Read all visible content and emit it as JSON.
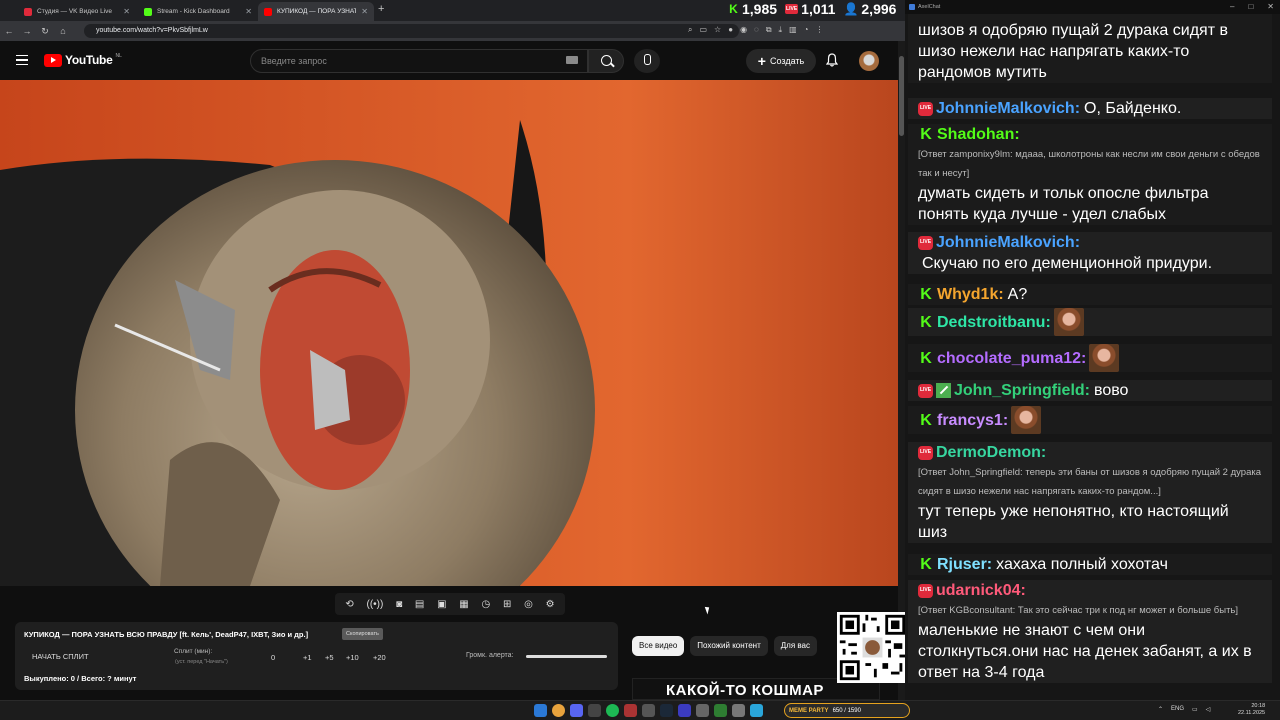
{
  "browser": {
    "tabs": [
      {
        "title": "Студия — VK Видео Live",
        "color": "#e02a3b"
      },
      {
        "title": "Stream - Kick Dashboard",
        "color": "#53fc18"
      },
      {
        "title": "КУПИКОД — ПОРА УЗНАТ",
        "color": "#ff0000"
      }
    ],
    "url": "youtube.com/watch?v=PkvSbfjlmLw"
  },
  "stream_stats": {
    "kick_viewers": "1,985",
    "vk_viewers": "1,011",
    "total_viewers": "2,996"
  },
  "youtube": {
    "logo_text": "YouTube",
    "logo_country": "NL",
    "search_placeholder": "Введите запрос",
    "create_label": "Создать"
  },
  "player_overlay": {
    "split_title": "КУПИКОД — ПОРА УЗНАТЬ ВСЮ ПРАВДУ [ft. Кель', DeadP47, IXBT, Зио и др.]",
    "split_tag": "Скопировать",
    "start_split": "НАЧАТЬ СПЛИТ",
    "split_label": "Сплит (мин):",
    "split_hint": "(уст. перед \"Начать\")",
    "split_value": "0",
    "steps": [
      "+1",
      "+5",
      "+10",
      "+20"
    ],
    "alert_label": "Громк. алерта:",
    "alert_level": 1.0,
    "bought": "Выкуплено: 0 / Всего: ? минут"
  },
  "chips": [
    "Все видео",
    "Похожий контент",
    "Для вас"
  ],
  "thumbnail_text": "КАКОЙ-ТО КОШМАР",
  "chat": {
    "window_title": "AxelChat",
    "messages": [
      {
        "platform": "",
        "nick": "",
        "nick_color": "#ffffff",
        "reply": "",
        "text": "шизов я одобряю   пущай 2 дурака сидят в шизо нежели нас напрягать каких-то рандомов мутить",
        "emote": false
      },
      {
        "platform": "vk",
        "nick": "JohnnieMalkovich:",
        "nick_color": "#4aa3ff",
        "reply": "",
        "text": "О, Байденко.",
        "emote": false
      },
      {
        "platform": "kick",
        "nick": "Shadohan:",
        "nick_color": "#53fc18",
        "reply": "[Ответ zamponixy9lm: мдааа, школотроны как несли им свои деньги с обедов так и несут]",
        "text": "думать сидеть и тольк опосле фильтра понять куда лучше - удел слабых",
        "emote": false
      },
      {
        "platform": "vk",
        "nick": "JohnnieMalkovich:",
        "nick_color": "#4aa3ff",
        "reply": "",
        "text": "Скучаю по его деменционной придури.",
        "emote": false
      },
      {
        "platform": "kick",
        "nick": "Whyd1k:",
        "nick_color": "#f4a52e",
        "reply": "",
        "text": "А?",
        "emote": false
      },
      {
        "platform": "kick",
        "nick": "Dedstroitbanu:",
        "nick_color": "#2ee6a6",
        "reply": "",
        "text": "",
        "emote": true
      },
      {
        "platform": "kick",
        "nick": "chocolate_puma12:",
        "nick_color": "#b46cff",
        "reply": "",
        "text": "",
        "emote": true
      },
      {
        "platform": "vk",
        "nick": "John_Springfield:",
        "nick_color": "#33d17a",
        "reply": "",
        "text": "вово",
        "emote": false
      },
      {
        "platform": "kick",
        "nick": "francys1:",
        "nick_color": "#c88cff",
        "reply": "",
        "text": "",
        "emote": true
      },
      {
        "platform": "vk",
        "nick": "DermoDemon:",
        "nick_color": "#37d6a0",
        "reply": "[Ответ John_Springfield: теперь эти баны от шизов я одобряю   пущай 2 дурака сидят в шизо нежели нас напрягать каких-то рандом...]",
        "text": "тут теперь уже непонятно, кто настоящий шиз",
        "emote": false
      },
      {
        "platform": "kick",
        "nick": "Rjuser:",
        "nick_color": "#7fe0ff",
        "reply": "",
        "text": "хахаха полный хохотач",
        "emote": false
      },
      {
        "platform": "vk",
        "nick": "udarnick04:",
        "nick_color": "#ff5a7a",
        "reply": "[Ответ KGBconsultant: Так это сейчас три к под нг может и больше быть]",
        "text": "маленькие не знают с чем они столкнуться.они нас на денек забанят, а их в ответ на 3-4 года",
        "emote": false
      }
    ]
  },
  "taskbar": {
    "meme_party": "MEME PARTY",
    "meme_progress": "650 / 1590",
    "lang": "ENG",
    "time": "20:18",
    "date": "22.11.2025"
  }
}
